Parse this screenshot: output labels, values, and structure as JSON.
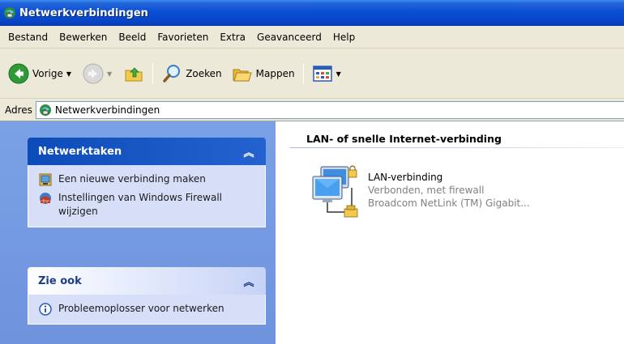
{
  "window": {
    "title": "Netwerkverbindingen"
  },
  "menu": [
    "Bestand",
    "Bewerken",
    "Beeld",
    "Favorieten",
    "Extra",
    "Geavanceerd",
    "Help"
  ],
  "toolbar": {
    "back_label": "Vorige",
    "search_label": "Zoeken",
    "folders_label": "Mappen"
  },
  "address": {
    "label": "Adres",
    "value": "Netwerkverbindingen"
  },
  "sidebar": {
    "network_tasks": {
      "title": "Netwerktaken",
      "items": [
        {
          "label": "Een nieuwe verbinding maken",
          "icon": "new-connection-icon"
        },
        {
          "label": "Instellingen van Windows Firewall wijzigen",
          "icon": "firewall-icon"
        }
      ]
    },
    "see_also": {
      "title": "Zie ook",
      "items": [
        {
          "label": "Probleemoplosser voor netwerken",
          "icon": "info-icon"
        }
      ]
    }
  },
  "content": {
    "group_title": "LAN- of snelle Internet-verbinding",
    "connection": {
      "name": "LAN-verbinding",
      "status": "Verbonden, met firewall",
      "device": "Broadcom NetLink (TM) Gigabit..."
    }
  },
  "colors": {
    "titlebar": "#0a4fd4",
    "menubar": "#ece9d8",
    "taskpane": "#7aa1e6",
    "panel_header_blue": "#0c4bb8",
    "panel_body": "#d6dff7"
  }
}
